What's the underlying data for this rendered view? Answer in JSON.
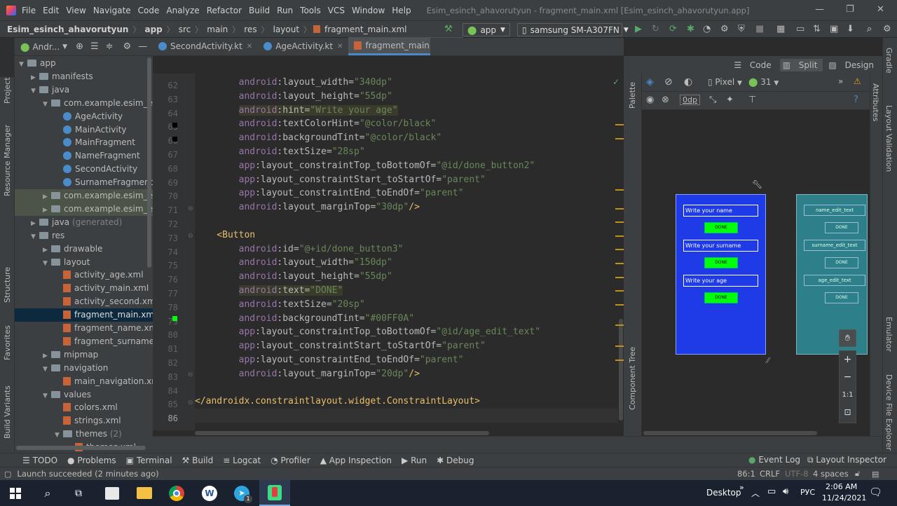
{
  "menu": {
    "items": [
      "File",
      "Edit",
      "View",
      "Navigate",
      "Code",
      "Analyze",
      "Refactor",
      "Build",
      "Run",
      "Tools",
      "VCS",
      "Window",
      "Help"
    ],
    "window_title": "Esim_esinch_ahavorutyun - fragment_main.xml [Esim_esinch_ahavorutyun.app]"
  },
  "breadcrumb": [
    "Esim_esinch_ahavorutyun",
    "app",
    "src",
    "main",
    "res",
    "layout",
    "fragment_main.xml"
  ],
  "toolbar": {
    "config": "app",
    "device": "samsung SM-A307FN"
  },
  "project": {
    "view_label": "Andr...",
    "tree": [
      {
        "label": "app",
        "depth": 0,
        "open": true,
        "kind": "folder"
      },
      {
        "label": "manifests",
        "depth": 1,
        "open": false,
        "kind": "folder"
      },
      {
        "label": "java",
        "depth": 1,
        "open": true,
        "kind": "folder"
      },
      {
        "label": "com.example.esim_esinch",
        "depth": 2,
        "open": true,
        "kind": "pkg"
      },
      {
        "label": "AgeActivity",
        "depth": 3,
        "kind": "kt"
      },
      {
        "label": "MainActivity",
        "depth": 3,
        "kind": "kt"
      },
      {
        "label": "MainFragment",
        "depth": 3,
        "kind": "kt"
      },
      {
        "label": "NameFragment",
        "depth": 3,
        "kind": "kt"
      },
      {
        "label": "SecondActivity",
        "depth": 3,
        "kind": "kt"
      },
      {
        "label": "SurnameFragment",
        "depth": 3,
        "kind": "kt"
      },
      {
        "label": "com.example.esim_esinch",
        "depth": 2,
        "open": false,
        "kind": "pkg",
        "hl": true
      },
      {
        "label": "com.example.esim_esinch",
        "depth": 2,
        "open": false,
        "kind": "pkg",
        "hl": true
      },
      {
        "label": "java",
        "suffix": " (generated)",
        "depth": 1,
        "open": false,
        "kind": "folder"
      },
      {
        "label": "res",
        "depth": 1,
        "open": true,
        "kind": "folder"
      },
      {
        "label": "drawable",
        "depth": 2,
        "open": false,
        "kind": "folder"
      },
      {
        "label": "layout",
        "depth": 2,
        "open": true,
        "kind": "folder"
      },
      {
        "label": "activity_age.xml",
        "depth": 3,
        "kind": "xml"
      },
      {
        "label": "activity_main.xml",
        "depth": 3,
        "kind": "xml"
      },
      {
        "label": "activity_second.xml",
        "depth": 3,
        "kind": "xml"
      },
      {
        "label": "fragment_main.xml",
        "depth": 3,
        "kind": "xml",
        "sel": true
      },
      {
        "label": "fragment_name.xml",
        "depth": 3,
        "kind": "xml"
      },
      {
        "label": "fragment_surname.xml",
        "depth": 3,
        "kind": "xml"
      },
      {
        "label": "mipmap",
        "depth": 2,
        "open": false,
        "kind": "folder"
      },
      {
        "label": "navigation",
        "depth": 2,
        "open": true,
        "kind": "folder"
      },
      {
        "label": "main_navigation.xml",
        "depth": 3,
        "kind": "xml"
      },
      {
        "label": "values",
        "depth": 2,
        "open": true,
        "kind": "folder"
      },
      {
        "label": "colors.xml",
        "depth": 3,
        "kind": "xml"
      },
      {
        "label": "strings.xml",
        "depth": 3,
        "kind": "xml"
      },
      {
        "label": "themes",
        "suffix": " (2)",
        "depth": 3,
        "open": true,
        "kind": "folder"
      },
      {
        "label": "themes.xml",
        "depth": 4,
        "kind": "xml"
      }
    ]
  },
  "left_strip": [
    "Project",
    "Resource Manager",
    "Structure",
    "Favorites",
    "Build Variants"
  ],
  "right_strip": [
    "Gradle",
    "Layout Validation",
    "Emulator",
    "Device File Explorer"
  ],
  "tabs": [
    {
      "label": "SecondActivity.kt",
      "active": false
    },
    {
      "label": "AgeActivity.kt",
      "active": false
    },
    {
      "label": "fragment_main.xml",
      "active": true
    }
  ],
  "modes": {
    "code": "Code",
    "split": "Split",
    "design": "Design"
  },
  "gutter_lines": [
    "62",
    "63",
    "64",
    "65",
    "66",
    "67",
    "68",
    "69",
    "70",
    "71",
    "72",
    "73",
    "74",
    "75",
    "76",
    "77",
    "78",
    "79",
    "80",
    "81",
    "82",
    "83",
    "84",
    "85",
    "86"
  ],
  "code_lines": [
    [
      [
        "ns",
        "        android"
      ],
      [
        "at",
        ":layout_width="
      ],
      [
        "st",
        "\"340dp\""
      ]
    ],
    [
      [
        "ns",
        "        android"
      ],
      [
        "at",
        ":layout_height="
      ],
      [
        "st",
        "\"55dp\""
      ]
    ],
    [
      [
        "ns",
        "        android"
      ],
      [
        "at",
        ":hint="
      ],
      [
        "st",
        "\"Write your age\""
      ]
    ],
    [
      [
        "ns",
        "        android"
      ],
      [
        "at",
        ":textColorHint="
      ],
      [
        "st",
        "\"@color/black\""
      ]
    ],
    [
      [
        "ns",
        "        android"
      ],
      [
        "at",
        ":backgroundTint="
      ],
      [
        "st",
        "\"@color/black\""
      ]
    ],
    [
      [
        "ns",
        "        android"
      ],
      [
        "at",
        ":textSize="
      ],
      [
        "st",
        "\"28sp\""
      ]
    ],
    [
      [
        "ns",
        "        app"
      ],
      [
        "at",
        ":layout_constraintTop_toBottomOf="
      ],
      [
        "st",
        "\"@id/done_button2\""
      ]
    ],
    [
      [
        "ns",
        "        app"
      ],
      [
        "at",
        ":layout_constraintStart_toStartOf="
      ],
      [
        "st",
        "\"parent\""
      ]
    ],
    [
      [
        "ns",
        "        app"
      ],
      [
        "at",
        ":layout_constraintEnd_toEndOf="
      ],
      [
        "st",
        "\"parent\""
      ]
    ],
    [
      [
        "ns",
        "        android"
      ],
      [
        "at",
        ":layout_marginTop="
      ],
      [
        "st",
        "\"30dp\""
      ],
      [
        "tg",
        "/>"
      ]
    ],
    [],
    [
      [
        "tg",
        "    <Button"
      ]
    ],
    [
      [
        "ns",
        "        android"
      ],
      [
        "at",
        ":id="
      ],
      [
        "st",
        "\"@+id/done_button3\""
      ]
    ],
    [
      [
        "ns",
        "        android"
      ],
      [
        "at",
        ":layout_width="
      ],
      [
        "st",
        "\"150dp\""
      ]
    ],
    [
      [
        "ns",
        "        android"
      ],
      [
        "at",
        ":layout_height="
      ],
      [
        "st",
        "\"55dp\""
      ]
    ],
    [
      [
        "ns",
        "        android"
      ],
      [
        "at",
        ":text="
      ],
      [
        "st",
        "\"DONE\""
      ]
    ],
    [
      [
        "ns",
        "        android"
      ],
      [
        "at",
        ":textSize="
      ],
      [
        "st",
        "\"20sp\""
      ]
    ],
    [
      [
        "ns",
        "        android"
      ],
      [
        "at",
        ":backgroundTint="
      ],
      [
        "st",
        "\"#00FF0A\""
      ]
    ],
    [
      [
        "ns",
        "        app"
      ],
      [
        "at",
        ":layout_constraintTop_toBottomOf="
      ],
      [
        "st",
        "\"@id/age_edit_text\""
      ]
    ],
    [
      [
        "ns",
        "        app"
      ],
      [
        "at",
        ":layout_constraintStart_toStartOf="
      ],
      [
        "st",
        "\"parent\""
      ]
    ],
    [
      [
        "ns",
        "        app"
      ],
      [
        "at",
        ":layout_constraintEnd_toEndOf="
      ],
      [
        "st",
        "\"parent\""
      ]
    ],
    [
      [
        "ns",
        "        android"
      ],
      [
        "at",
        ":layout_marginTop="
      ],
      [
        "st",
        "\"20dp\""
      ],
      [
        "tg",
        "/>"
      ]
    ],
    [],
    [
      [
        "tg",
        "</androidx.constraintlayout.widget.ConstraintLayout>"
      ]
    ],
    []
  ],
  "design": {
    "pixel_label": "Pixel",
    "api_label": "31",
    "margin_label": "0dp",
    "palette_label": "Palette",
    "component_tree_label": "Component Tree",
    "attributes_label": "Attributes",
    "preview": {
      "name_hint": "Write your name",
      "surname_hint": "Write your surname",
      "age_hint": "Write your age",
      "done": "DONE"
    },
    "blueprint": {
      "name_id": "name_edit_text",
      "surname_id": "surname_edit_text",
      "age_id": "age_edit_text",
      "done": "DONE"
    },
    "zoom": {
      "plus": "+",
      "minus": "−",
      "fit": "1:1"
    }
  },
  "bottom_tabs": [
    "TODO",
    "Problems",
    "Terminal",
    "Build",
    "Logcat",
    "Profiler",
    "App Inspection",
    "Run",
    "Debug"
  ],
  "bottom_right_tabs": [
    "Event Log",
    "Layout Inspector"
  ],
  "status": {
    "message": "Launch succeeded (2 minutes ago)",
    "position": "86:1",
    "line_sep": "CRLF",
    "encoding": "UTF-8",
    "indent": "4 spaces"
  },
  "taskbar": {
    "desktop": "Desktop",
    "lang": "РУС",
    "time": "2:06 AM",
    "date": "11/24/2021",
    "badge": "1"
  },
  "colors": {
    "accent": "#4a88c7",
    "preview_bg": "#1f3be8",
    "done_green": "#00ff0a",
    "blueprint_bg": "#2d7f8a"
  }
}
